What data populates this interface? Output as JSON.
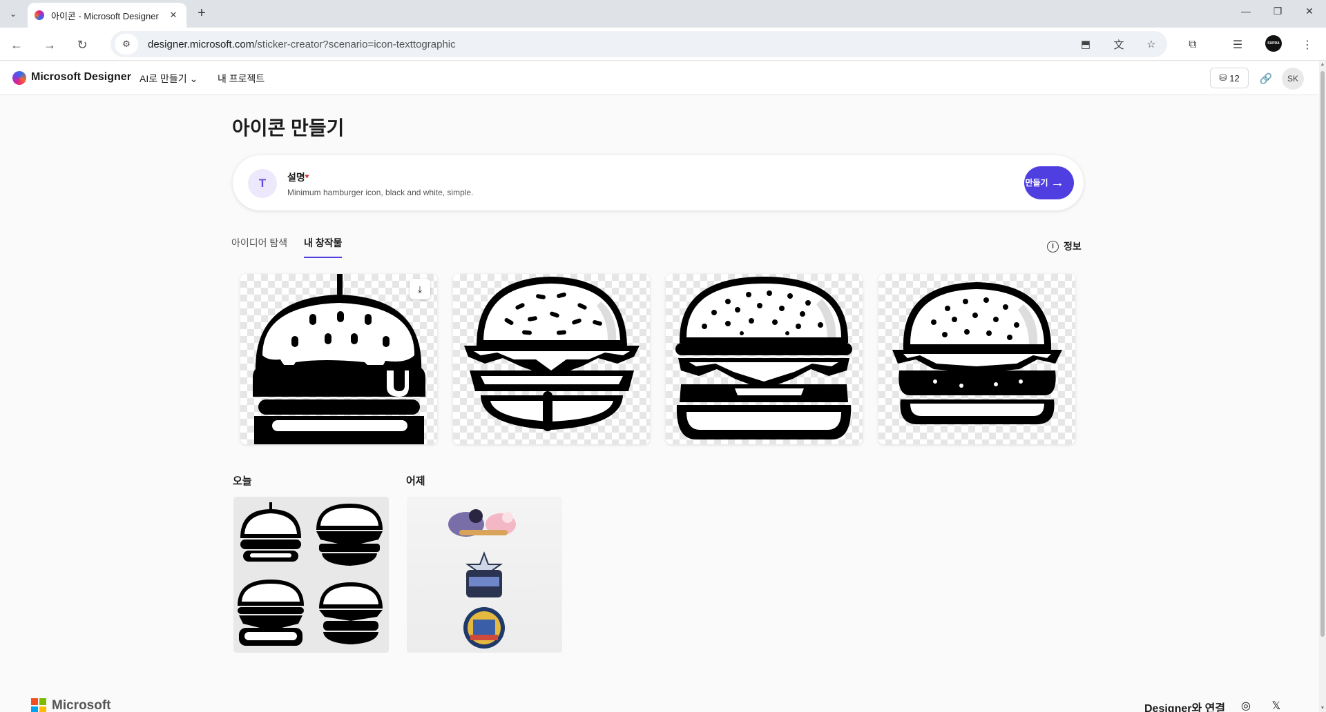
{
  "browser": {
    "tab_title": "아이콘 - Microsoft Designer",
    "url_host": "designer.microsoft.com",
    "url_path": "/sticker-creator?scenario=icon-texttographic",
    "profile_badge": "SUPRA"
  },
  "header": {
    "brand": "Microsoft Designer",
    "menu_ai": "AI로 만들기",
    "menu_projects": "내 프로젝트",
    "credits": "12",
    "avatar_initials": "SK"
  },
  "main": {
    "title": "아이콘 만들기",
    "prompt": {
      "label": "설명",
      "required_mark": "*",
      "text": "Minimum hamburger icon, black and white, simple."
    },
    "generate_label": "만들기",
    "tabs": [
      {
        "label": "아이디어 탐색",
        "active": false
      },
      {
        "label": "내 창작물",
        "active": true
      }
    ],
    "info_label": "정보",
    "results": [
      {
        "icon": "hamburger-icon-1"
      },
      {
        "icon": "hamburger-icon-2"
      },
      {
        "icon": "hamburger-icon-3"
      },
      {
        "icon": "hamburger-icon-4"
      }
    ],
    "history": {
      "today_label": "오늘",
      "yesterday_label": "어제"
    }
  },
  "footer": {
    "brand": "Microsoft",
    "connect": "Designer와 연결",
    "social": [
      "instagram-icon",
      "x-icon"
    ]
  },
  "colors": {
    "accent": "#4f3fe0",
    "active_tab_underline": "#4f3fe0",
    "required": "#c4262e"
  }
}
